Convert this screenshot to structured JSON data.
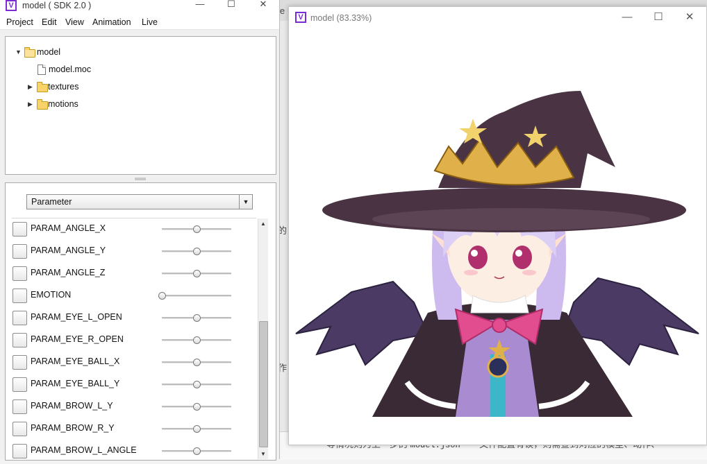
{
  "sdk_window": {
    "title": "model ( SDK 2.0 )",
    "app_icon": "V",
    "controls": {
      "minimize": "—",
      "maximize": "☐",
      "close": "✕"
    },
    "menu": [
      "Project",
      "Edit",
      "View",
      "Animation",
      "Live"
    ]
  },
  "tree": {
    "items": [
      {
        "label": "model",
        "icon": "folder-open-icon",
        "expanded": true
      },
      {
        "label": "model.moc",
        "icon": "file-icon"
      },
      {
        "label": "textures",
        "icon": "folder-icon",
        "expanded": false
      },
      {
        "label": "motions",
        "icon": "folder-icon",
        "expanded": false
      }
    ]
  },
  "parameters": {
    "dropdown_selected": "Parameter",
    "items": [
      {
        "name": "PARAM_ANGLE_X",
        "value": 0.5
      },
      {
        "name": "PARAM_ANGLE_Y",
        "value": 0.5
      },
      {
        "name": "PARAM_ANGLE_Z",
        "value": 0.5
      },
      {
        "name": "EMOTION",
        "value": 0.0
      },
      {
        "name": "PARAM_EYE_L_OPEN",
        "value": 0.5
      },
      {
        "name": "PARAM_EYE_R_OPEN",
        "value": 0.5
      },
      {
        "name": "PARAM_EYE_BALL_X",
        "value": 0.5
      },
      {
        "name": "PARAM_EYE_BALL_Y",
        "value": 0.5
      },
      {
        "name": "PARAM_BROW_L_Y",
        "value": 0.5
      },
      {
        "name": "PARAM_BROW_R_Y",
        "value": 0.5
      },
      {
        "name": "PARAM_BROW_L_ANGLE",
        "value": 0.5
      }
    ]
  },
  "model_window": {
    "title": "model (83.33%)",
    "app_icon": "V",
    "controls": {
      "minimize": "—",
      "maximize": "☐",
      "close": "✕"
    }
  },
  "background": {
    "edge_text_1": "le",
    "edge_text_2": "的",
    "edge_text_3": "作",
    "bottom_text": "等情况则为上一步的",
    "code_text": "model.json",
    "bottom_text_2": "文件配置有误，则需查到对应的模型、动作、"
  },
  "colors": {
    "accent": "#7a2bd6",
    "hat": "#4a3444",
    "hair": "#d9c9f2",
    "bow": "#e14d8f",
    "wing": "#4b3a63",
    "gold": "#e0b04a"
  }
}
